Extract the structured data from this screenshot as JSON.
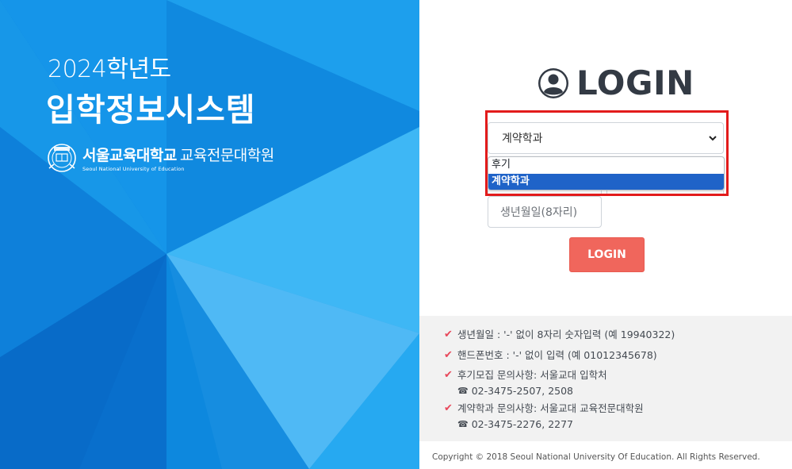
{
  "left_panel": {
    "year_text": "2024학년도",
    "system_title": "입학정보시스템",
    "univ_name_ko": "서울교육대학교",
    "grad_school_ko": "교육전문대학원",
    "univ_name_en": "Seoul National University of Education",
    "seal_icon": "university-seal-icon"
  },
  "login": {
    "title": "LOGIN",
    "title_icon": "user-circle-icon",
    "select_value": "계약학과",
    "options": [
      "후기",
      "계약학과"
    ],
    "highlighted_option": "계약학과",
    "birth_placeholder": "생년월일(8자리)",
    "button_label": "LOGIN"
  },
  "notices": [
    {
      "text": "생년월일 : '-' 없이 8자리 숫자입력 (예 19940322)"
    },
    {
      "text": "핸드폰번호 : '-' 없이 입력 (예 01012345678)"
    },
    {
      "text": "후기모집 문의사항: 서울교대 입학처",
      "phone": "02-3475-2507, 2508"
    },
    {
      "text": "계약학과 문의사항: 서울교대 교육전문대학원",
      "phone": "02-3475-2276, 2277"
    }
  ],
  "phone_glyph": "☎",
  "check_glyph": "✔",
  "footer": {
    "copyright": "Copyright © 2018 Seoul National University Of Education. All Rights Reserved."
  },
  "colors": {
    "accent_blue": "#1493e6",
    "login_button": "#f0665c",
    "highlight_red": "#e21b1b",
    "selected_option": "#1f63c8",
    "check": "#e8475a"
  }
}
